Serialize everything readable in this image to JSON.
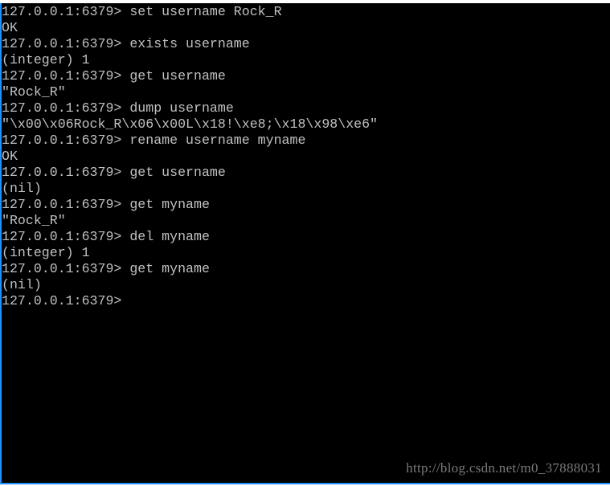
{
  "terminal": {
    "lines": [
      "127.0.0.1:6379> set username Rock_R",
      "OK",
      "127.0.0.1:6379> exists username",
      "(integer) 1",
      "127.0.0.1:6379> get username",
      "\"Rock_R\"",
      "127.0.0.1:6379> dump username",
      "\"\\x00\\x06Rock_R\\x06\\x00L\\x18!\\xe8;\\x18\\x98\\xe6\"",
      "127.0.0.1:6379> rename username myname",
      "OK",
      "127.0.0.1:6379> get username",
      "(nil)",
      "127.0.0.1:6379> get myname",
      "\"Rock_R\"",
      "127.0.0.1:6379> del myname",
      "(integer) 1",
      "127.0.0.1:6379> get myname",
      "(nil)",
      "127.0.0.1:6379> "
    ]
  },
  "watermark": "http://blog.csdn.net/m0_37888031",
  "colors": {
    "background": "#000000",
    "text": "#c0c0c0",
    "border": "#1e90ff"
  }
}
